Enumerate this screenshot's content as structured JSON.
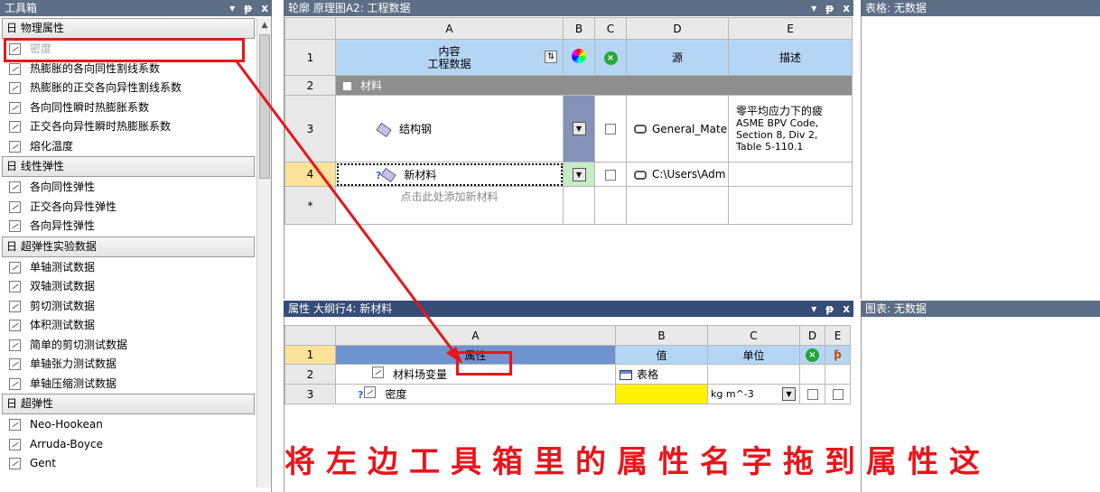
{
  "toolbox": {
    "title": "工具箱",
    "ctrl_dropdown": "▾",
    "ctrl_pin": "ㅁ",
    "ctrl_close": "x",
    "categories": [
      {
        "label": "日 物理属性",
        "items": [
          "密度",
          "热膨胀的各向同性割线系数",
          "热膨胀的正交各向异性割线系数",
          "各向同性瞬时热膨胀系数",
          "正交各向异性瞬时热膨胀系数",
          "熔化温度"
        ]
      },
      {
        "label": "日 线性弹性",
        "items": [
          "各向同性弹性",
          "正交各向异性弹性",
          "各向异性弹性"
        ]
      },
      {
        "label": "日 超弹性实验数据",
        "items": [
          "单轴测试数据",
          "双轴测试数据",
          "剪切测试数据",
          "体积测试数据",
          "简单的剪切测试数据",
          "单轴张力测试数据",
          "单轴压缩测试数据"
        ]
      },
      {
        "label": "日 超弹性",
        "items": [
          "Neo-Hookean",
          "Arruda-Boyce",
          "Gent"
        ]
      }
    ]
  },
  "outline": {
    "title": "轮廓 原理图A2: 工程数据",
    "col_headers": [
      "A",
      "B",
      "C",
      "D",
      "E"
    ],
    "row1": {
      "num": "1",
      "content_line1": "内容",
      "content_line2": "工程数据",
      "source": "源",
      "description": "描述"
    },
    "row2": {
      "num": "2",
      "label": "材料",
      "toggle": "□"
    },
    "row3": {
      "num": "3",
      "name": "结构钢",
      "source": "General_Mate",
      "desc1": "零平均应力下的疲",
      "desc2": "ASME BPV Code,",
      "desc3": "Section 8, Div 2,",
      "desc4": "Table 5-110.1"
    },
    "row4": {
      "num": "4",
      "name": "新材料",
      "source": "C:\\Users\\Adm"
    },
    "row_new": {
      "num": "*",
      "placeholder": "点击此处添加新材料"
    }
  },
  "table_panel": {
    "title": "表格: 无数据"
  },
  "chart_panel": {
    "title": "图表: 无数据"
  },
  "properties": {
    "title": "属性 大纲行4: 新材料",
    "col_headers": [
      "A",
      "B",
      "C",
      "D",
      "E"
    ],
    "row1": {
      "num": "1",
      "property": "属性",
      "value": "值",
      "unit": "单位"
    },
    "row2": {
      "num": "2",
      "name": "材料场变量",
      "value": "表格"
    },
    "row3": {
      "num": "3",
      "name": "密度",
      "unit": "kg m^-3"
    }
  },
  "annotation": {
    "caption": "将左边工具箱里的属性名字拖到属性这",
    "color": "#e8151b"
  }
}
